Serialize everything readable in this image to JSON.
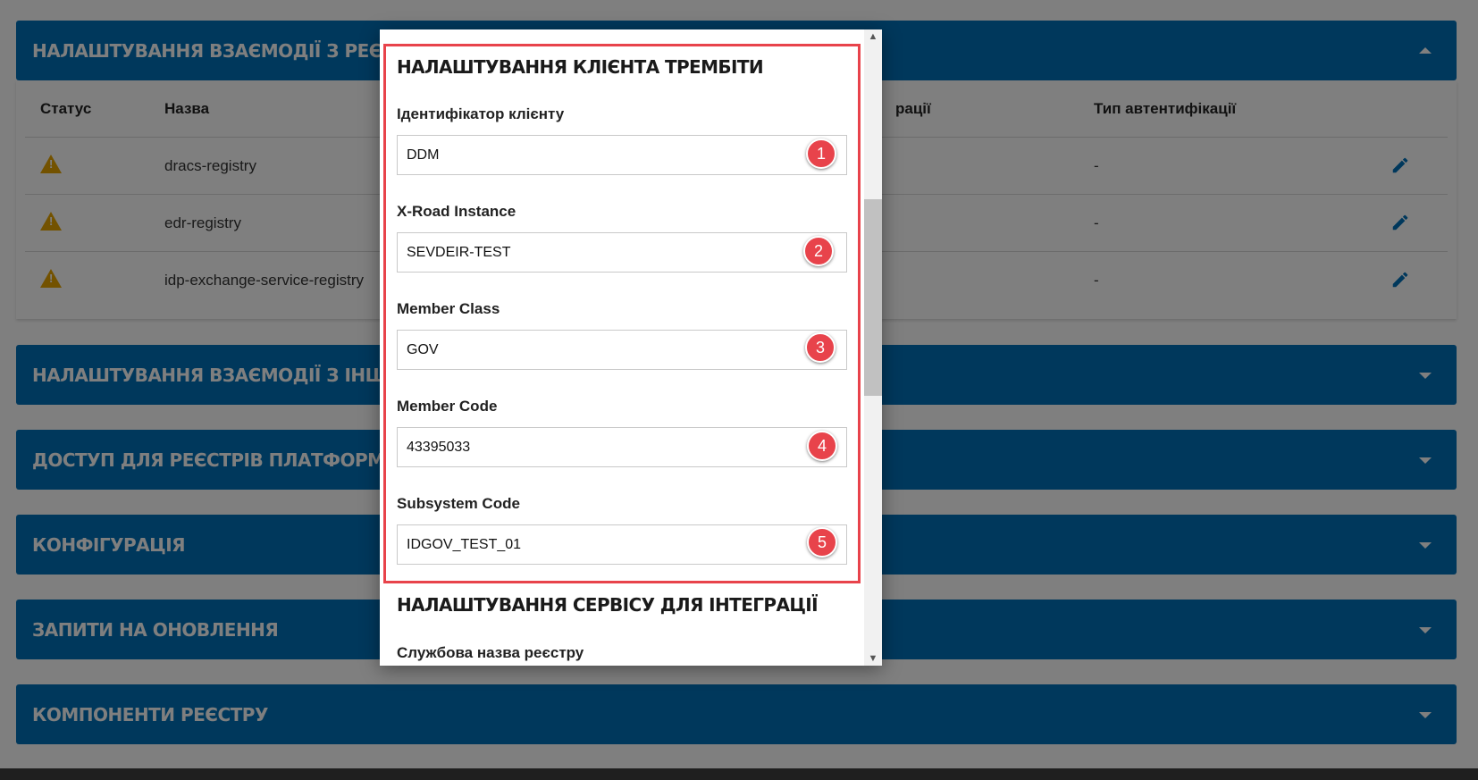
{
  "panels": {
    "registries": {
      "title": "НАЛАШТУВАННЯ ВЗАЄМОДІЇ З РЕЄСТРАМИ ЧЕР",
      "columns": [
        "Статус",
        "Назва",
        "рації",
        "Тип автентифікації"
      ],
      "rows": [
        {
          "name": "dracs-registry",
          "auth": "-"
        },
        {
          "name": "edr-registry",
          "auth": "-"
        },
        {
          "name": "idp-exchange-service-registry",
          "auth": "-"
        }
      ]
    },
    "other_systems": {
      "title": "НАЛАШТУВАННЯ ВЗАЄМОДІЇ З ІНШИМИ СИСТЕМ"
    },
    "access": {
      "title": "ДОСТУП ДЛЯ РЕЄСТРІВ ПЛАТФОРМИ ТА ЗОВНІ"
    },
    "config": {
      "title": "КОНФІГУРАЦІЯ"
    },
    "update_requests": {
      "title": "ЗАПИТИ НА ОНОВЛЕННЯ"
    },
    "components": {
      "title": "КОМПОНЕНТИ РЕЄСТРУ"
    }
  },
  "modal": {
    "section1_title": "НАЛАШТУВАННЯ КЛІЄНТА ТРЕМБІТИ",
    "fields": [
      {
        "label": "Ідентифікатор клієнту",
        "value": "DDM",
        "badge": "1"
      },
      {
        "label": "X-Road Instance",
        "value": "SEVDEIR-TEST",
        "badge": "2"
      },
      {
        "label": "Member Class",
        "value": "GOV",
        "badge": "3"
      },
      {
        "label": "Member Code",
        "value": "43395033",
        "badge": "4"
      },
      {
        "label": "Subsystem Code",
        "value": "IDGOV_TEST_01",
        "badge": "5"
      }
    ],
    "section2_title": "НАЛАШТУВАННЯ СЕРВІСУ ДЛЯ ІНТЕГРАЦІЇ",
    "section2_field_label": "Службова назва реєстру"
  },
  "colors": {
    "panel_header": "#0070b8",
    "highlight": "#e8434b",
    "warning": "#e6a400",
    "edit_icon": "#0070b8"
  },
  "icons": {
    "status": "warning-triangle-icon",
    "edit": "pencil-icon",
    "caret": "caret-icon"
  }
}
